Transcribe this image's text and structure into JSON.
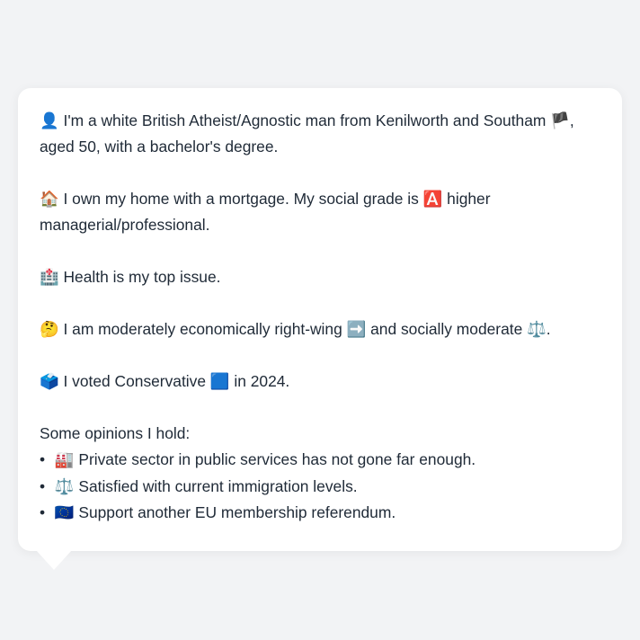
{
  "profile": {
    "intro_icon": "👤",
    "intro_text": "I'm a white British Atheist/Agnostic man from Kenilworth and Southam",
    "flag_icon": "🏴",
    "intro_tail": ", aged 50, with a bachelor's degree.",
    "home_icon": "🏠",
    "home_text": "I own my home with a mortgage. My social grade is",
    "grade_icon": "🅰️",
    "home_tail": "higher managerial/professional.",
    "health_icon": "🏥",
    "health_text": "Health is my top issue.",
    "thinking_icon": "🤔",
    "econ_text": "I am moderately economically right-wing",
    "right_icon": "➡️",
    "social_text": "and socially moderate",
    "balance_icon": "⚖️",
    "social_tail": ".",
    "ballot_icon": "🗳️",
    "vote_text": "I voted Conservative",
    "party_icon": "🟦",
    "vote_tail": "in 2024."
  },
  "opinions": {
    "label": "Some opinions I hold:",
    "bullet": "•",
    "items": [
      {
        "icon": "🏭",
        "text": "Private sector in public services has not gone far enough."
      },
      {
        "icon": "⚖️",
        "text": "Satisfied with current immigration levels."
      },
      {
        "icon": "🇪🇺",
        "text": "Support another EU membership referendum."
      }
    ]
  },
  "colors": {
    "background": "#f2f3f5",
    "bubble": "#ffffff",
    "text": "#1f2a37"
  }
}
